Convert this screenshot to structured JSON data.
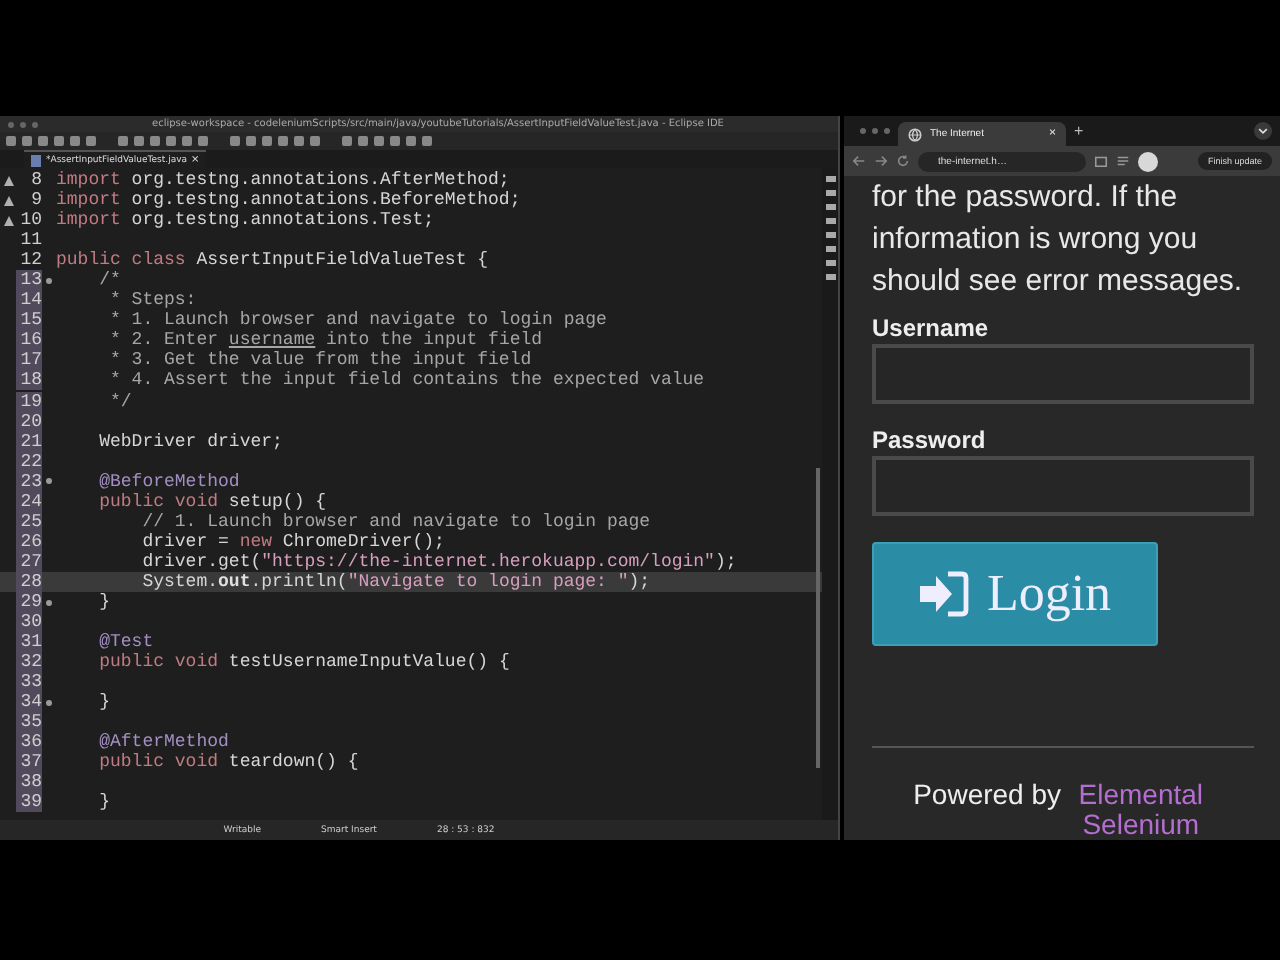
{
  "eclipse": {
    "title": "eclipse-workspace - codeleniumScripts/src/main/java/youtubeTutorials/AssertInputFieldValueTest.java - Eclipse IDE",
    "editor_tab": {
      "label": "*AssertInputFieldValueTest.java",
      "close": "×",
      "selected": true
    },
    "lines": [
      {
        "num": "8",
        "warning": true,
        "fold": false,
        "highlighted": false,
        "current": false,
        "tokens": [
          {
            "kind": "kw",
            "t": "import"
          },
          {
            "kind": "plain",
            "t": " org.testng.annotations.AfterMethod;"
          }
        ]
      },
      {
        "num": "9",
        "warning": true,
        "fold": false,
        "highlighted": false,
        "current": false,
        "tokens": [
          {
            "kind": "kw",
            "t": "import"
          },
          {
            "kind": "plain",
            "t": " org.testng.annotations.BeforeMethod;"
          }
        ]
      },
      {
        "num": "10",
        "warning": true,
        "fold": false,
        "highlighted": false,
        "current": false,
        "tokens": [
          {
            "kind": "kw",
            "t": "import"
          },
          {
            "kind": "plain",
            "t": " org.testng.annotations.Test;"
          }
        ]
      },
      {
        "num": "11",
        "warning": false,
        "fold": false,
        "highlighted": false,
        "current": false
      },
      {
        "num": "12",
        "warning": false,
        "fold": false,
        "highlighted": false,
        "current": false,
        "tokens": [
          {
            "kind": "kw",
            "t": "public class"
          },
          {
            "kind": "plain",
            "t": " AssertInputFieldValueTest {"
          }
        ]
      },
      {
        "num": "13",
        "warning": false,
        "fold": true,
        "highlighted": true,
        "current": false,
        "tokens": [
          {
            "kind": "comment",
            "t": "    /*"
          }
        ]
      },
      {
        "num": "14",
        "warning": false,
        "fold": false,
        "highlighted": true,
        "current": false,
        "tokens": [
          {
            "kind": "comment",
            "t": "     * Steps:"
          }
        ]
      },
      {
        "num": "15",
        "warning": false,
        "fold": false,
        "highlighted": true,
        "current": false,
        "tokens": [
          {
            "kind": "comment",
            "t": "     * 1. Launch browser and navigate to login page"
          }
        ]
      },
      {
        "num": "16",
        "warning": false,
        "fold": false,
        "highlighted": true,
        "current": false,
        "tokens": [
          {
            "kind": "comment",
            "t": "     * 2. Enter "
          },
          {
            "kind": "spell",
            "t": "username"
          },
          {
            "kind": "comment",
            "t": " into the input field"
          }
        ]
      },
      {
        "num": "17",
        "warning": false,
        "fold": false,
        "highlighted": true,
        "current": false,
        "tokens": [
          {
            "kind": "comment",
            "t": "     * 3. Get the value from the input field"
          }
        ]
      },
      {
        "num": "18",
        "warning": false,
        "fold": false,
        "highlighted": true,
        "current": false,
        "tokens": [
          {
            "kind": "comment",
            "t": "     * 4. Assert the input field contains the expected value"
          }
        ]
      },
      {
        "num": "19",
        "warning": false,
        "fold": false,
        "highlighted": true,
        "current": false,
        "tokens": [
          {
            "kind": "comment",
            "t": "     */"
          }
        ]
      },
      {
        "num": "20",
        "warning": false,
        "fold": false,
        "highlighted": true,
        "current": false
      },
      {
        "num": "21",
        "warning": false,
        "fold": false,
        "highlighted": true,
        "current": false,
        "tokens": [
          {
            "kind": "plain",
            "t": "    WebDriver driver;"
          }
        ]
      },
      {
        "num": "22",
        "warning": false,
        "fold": false,
        "highlighted": true,
        "current": false
      },
      {
        "num": "23",
        "warning": false,
        "fold": true,
        "highlighted": true,
        "current": false,
        "tokens": [
          {
            "kind": "ann",
            "t": "    @BeforeMethod"
          }
        ]
      },
      {
        "num": "24",
        "warning": false,
        "fold": false,
        "highlighted": true,
        "current": false,
        "tokens": [
          {
            "kind": "kw",
            "t": "    public void"
          },
          {
            "kind": "plain",
            "t": " setup() {"
          }
        ]
      },
      {
        "num": "25",
        "warning": false,
        "fold": false,
        "highlighted": true,
        "current": false,
        "tokens": [
          {
            "kind": "comment",
            "t": "        // 1. Launch browser and navigate to login page"
          }
        ]
      },
      {
        "num": "26",
        "warning": false,
        "fold": false,
        "highlighted": true,
        "current": false,
        "tokens": [
          {
            "kind": "plain",
            "t": "        driver = "
          },
          {
            "kind": "kw",
            "t": "new"
          },
          {
            "kind": "plain",
            "t": " ChromeDriver();"
          }
        ]
      },
      {
        "num": "27",
        "warning": false,
        "fold": false,
        "highlighted": true,
        "current": false,
        "tokens": [
          {
            "kind": "plain",
            "t": "        driver.get("
          },
          {
            "kind": "str",
            "t": "\"https://the-internet.herokuapp.com/login\""
          },
          {
            "kind": "plain",
            "t": ");"
          }
        ]
      },
      {
        "num": "28",
        "warning": false,
        "fold": false,
        "highlighted": true,
        "current": true,
        "tokens": [
          {
            "kind": "plain",
            "t": "        System."
          },
          {
            "kind": "field",
            "t": "out"
          },
          {
            "kind": "plain",
            "t": ".println("
          },
          {
            "kind": "str",
            "t": "\"Navigate to login page: \""
          },
          {
            "kind": "plain",
            "t": ");"
          }
        ]
      },
      {
        "num": "29",
        "warning": false,
        "fold": true,
        "highlighted": true,
        "current": false,
        "tokens": [
          {
            "kind": "plain",
            "t": "    }"
          }
        ]
      },
      {
        "num": "30",
        "warning": false,
        "fold": false,
        "highlighted": true,
        "current": false
      },
      {
        "num": "31",
        "warning": false,
        "fold": false,
        "highlighted": true,
        "current": false,
        "tokens": [
          {
            "kind": "ann",
            "t": "    @Test"
          }
        ]
      },
      {
        "num": "32",
        "warning": false,
        "fold": false,
        "highlighted": true,
        "current": false,
        "tokens": [
          {
            "kind": "kw",
            "t": "    public void"
          },
          {
            "kind": "plain",
            "t": " testUsernameInputValue() {"
          }
        ]
      },
      {
        "num": "33",
        "warning": false,
        "fold": false,
        "highlighted": true,
        "current": false
      },
      {
        "num": "34",
        "warning": false,
        "fold": true,
        "highlighted": true,
        "current": false,
        "tokens": [
          {
            "kind": "plain",
            "t": "    }"
          }
        ]
      },
      {
        "num": "35",
        "warning": false,
        "fold": false,
        "highlighted": true,
        "current": false
      },
      {
        "num": "36",
        "warning": false,
        "fold": false,
        "highlighted": true,
        "current": false,
        "tokens": [
          {
            "kind": "ann",
            "t": "    @AfterMethod"
          }
        ]
      },
      {
        "num": "37",
        "warning": false,
        "fold": false,
        "highlighted": true,
        "current": false,
        "tokens": [
          {
            "kind": "kw",
            "t": "    public void"
          },
          {
            "kind": "plain",
            "t": " teardown() {"
          }
        ]
      },
      {
        "num": "38",
        "warning": false,
        "fold": false,
        "highlighted": true,
        "current": false
      },
      {
        "num": "39",
        "warning": false,
        "fold": false,
        "highlighted": true,
        "current": false,
        "tokens": [
          {
            "kind": "plain",
            "t": "    }"
          }
        ]
      }
    ],
    "status_bar": [
      "Writable",
      "Smart Insert",
      "28 : 53 : 832"
    ]
  },
  "browser": {
    "tab": {
      "title": "The Internet",
      "close": "×",
      "selected": true
    },
    "new_tab": "+",
    "address": "the-internet.h…",
    "update_button": "Finish update",
    "intro_lines": [
      "for the password. If the",
      "information is wrong you",
      "should see error messages."
    ],
    "fields": [
      {
        "label": "Username"
      },
      {
        "label": "Password"
      }
    ],
    "login_button": "Login",
    "footer": {
      "text": "Powered by ",
      "link": "Elemental Selenium"
    }
  }
}
